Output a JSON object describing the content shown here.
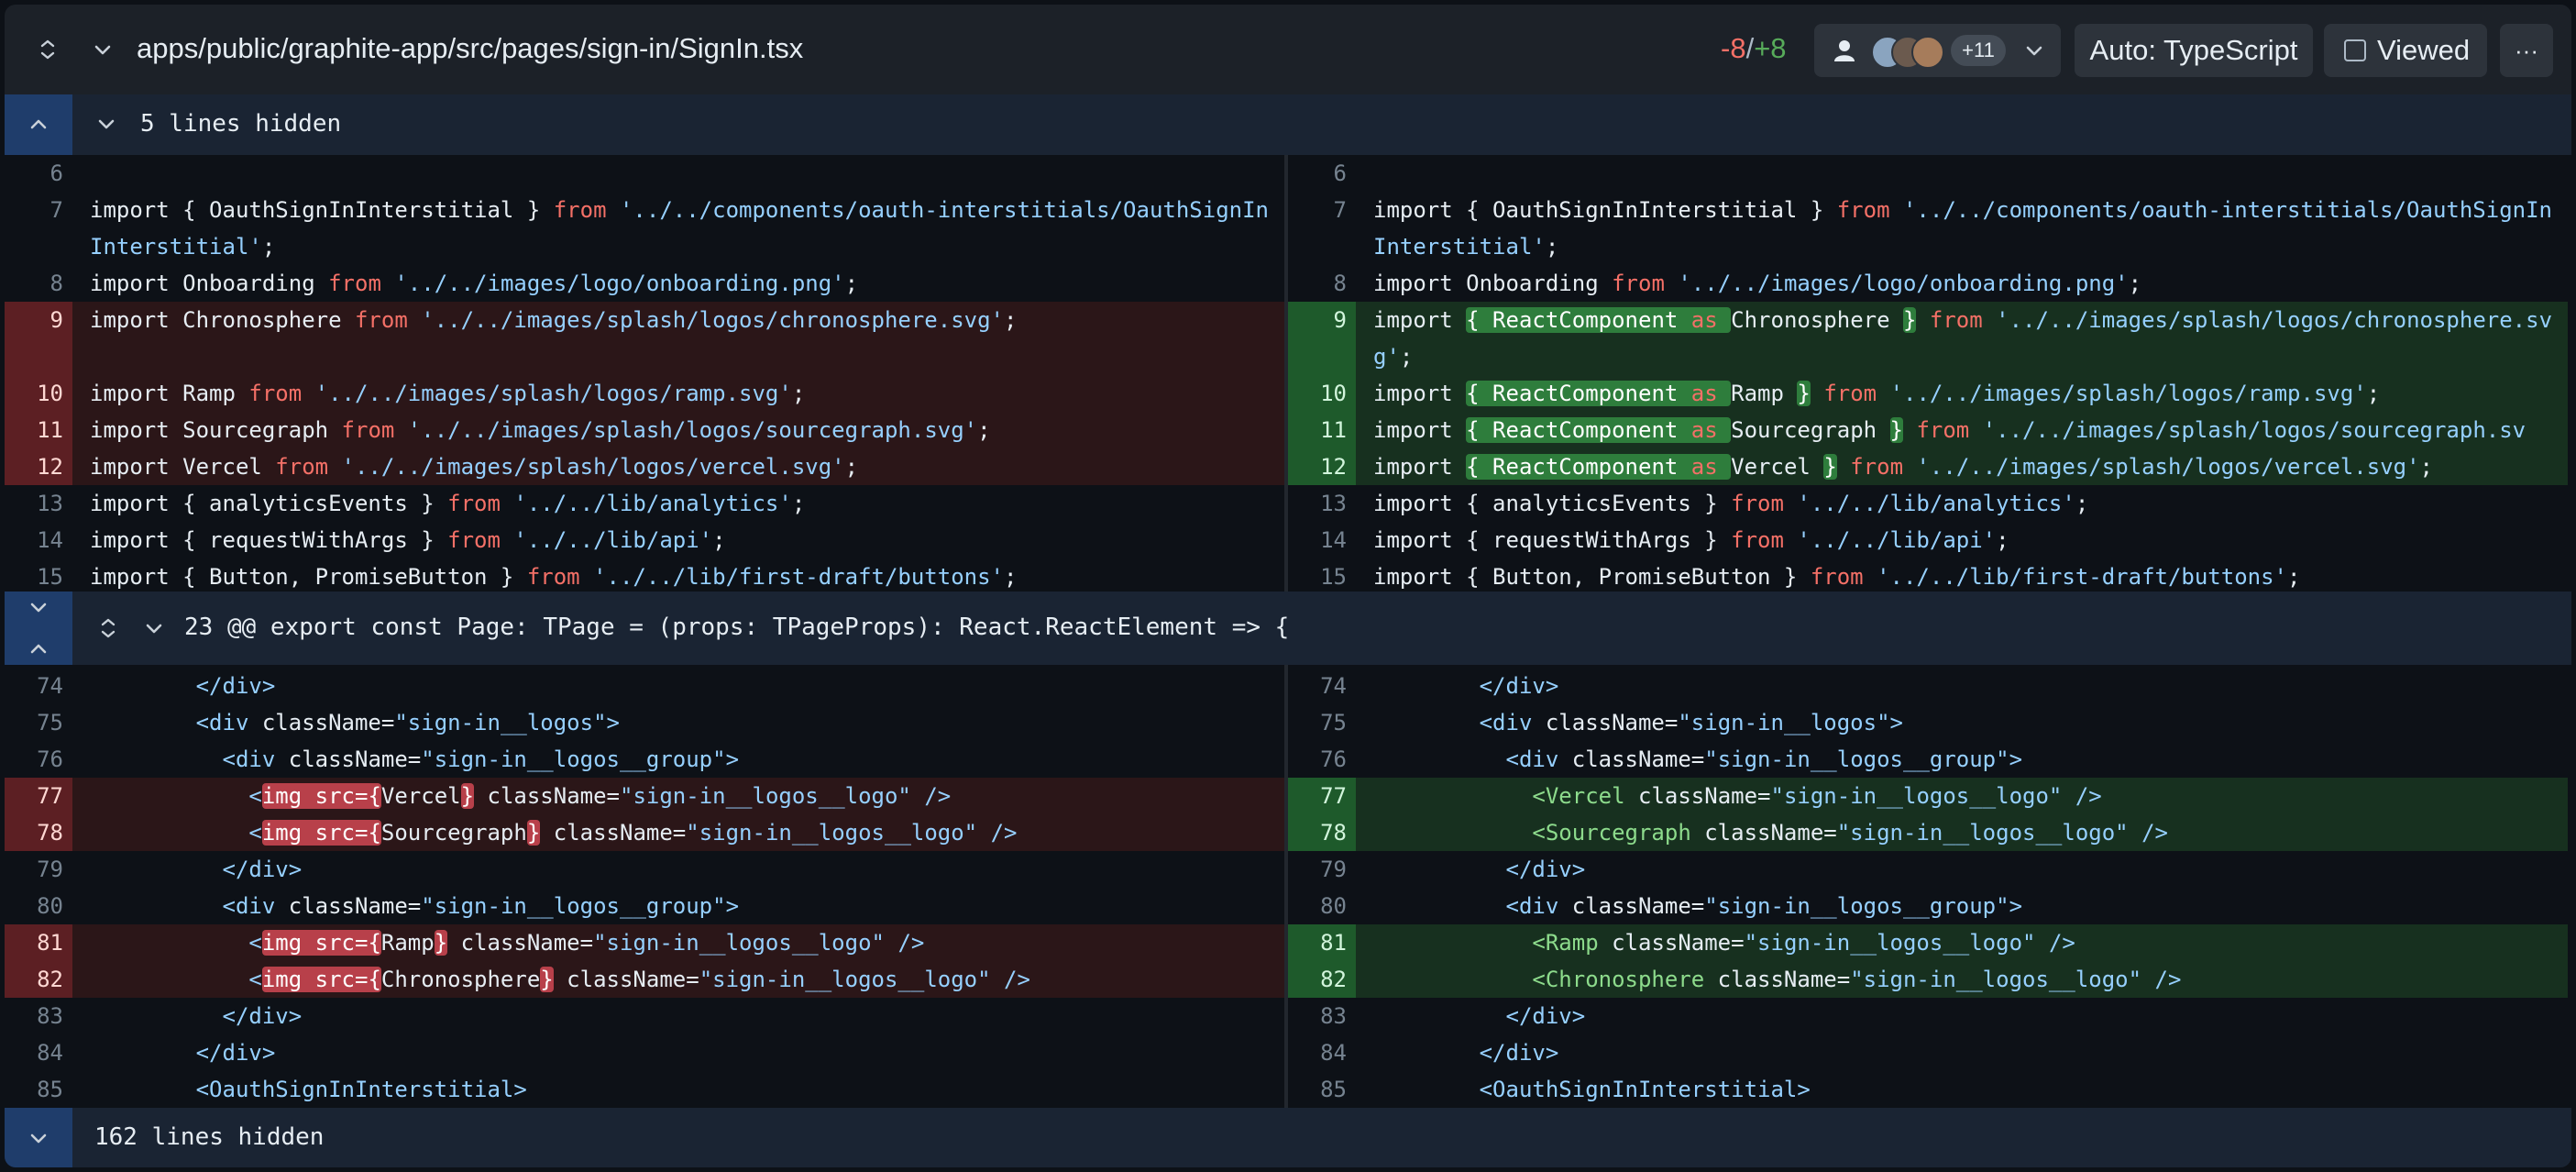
{
  "header": {
    "file_path": "apps/public/graphite-app/src/pages/sign-in/SignIn.tsx",
    "removed_count": "-8",
    "count_separator": "/",
    "added_count": "+8",
    "reviewer_extra_count": "+11",
    "language_label": "Auto: TypeScript",
    "viewed_label": "Viewed",
    "more_label": "···"
  },
  "hidden_top": {
    "label": "5 lines hidden"
  },
  "hunk": {
    "label": "23 @@ export const Page: TPage = (props: TPageProps): React.ReactElement => {"
  },
  "hidden_bottom": {
    "label": "162 lines hidden"
  },
  "lines": {
    "n6": "6",
    "n7": "7",
    "n8": "8",
    "n9": "9",
    "n10": "10",
    "n11": "11",
    "n12": "12",
    "n13": "13",
    "n14": "14",
    "n15": "15",
    "n74": "74",
    "n75": "75",
    "n76": "76",
    "n77": "77",
    "n78": "78",
    "n79": "79",
    "n80": "80",
    "n81": "81",
    "n82": "82",
    "n83": "83",
    "n84": "84",
    "n85": "85"
  },
  "colors": {
    "removed_bg": "#2b1618",
    "added_bg": "#17301f",
    "keyword": "#f47067",
    "string": "#96d0ff",
    "jsx_tag": "#8ddb8c"
  }
}
